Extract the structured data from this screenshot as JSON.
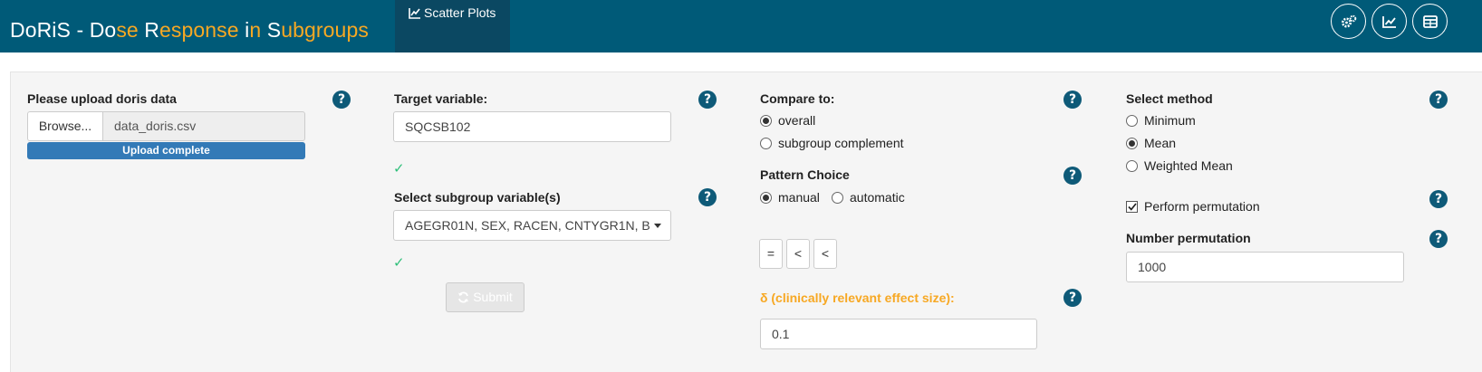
{
  "app": {
    "title_parts": [
      {
        "text": "DoRiS - Do",
        "hl": false
      },
      {
        "text": "se",
        "hl": true
      },
      {
        "text": " R",
        "hl": false
      },
      {
        "text": "esponse",
        "hl": true
      },
      {
        "text": " i",
        "hl": false
      },
      {
        "text": "n",
        "hl": true
      },
      {
        "text": " S",
        "hl": false
      },
      {
        "text": "ubgroups",
        "hl": true
      }
    ],
    "nav_tab": "Scatter Plots",
    "header_buttons": [
      "gears-icon",
      "line-chart-icon",
      "table-icon"
    ]
  },
  "colors": {
    "navbar": "#005a78",
    "accent": "#f7a823",
    "tab_active": "#0b4862",
    "progress": "#337ab7",
    "help": "#0e5a78",
    "check": "#2fbf7a"
  },
  "upload": {
    "label": "Please upload doris data",
    "browse_label": "Browse...",
    "filename": "data_doris.csv",
    "progress_text": "Upload complete",
    "progress": 1.0
  },
  "target": {
    "label": "Target variable:",
    "value": "SQCSB102"
  },
  "subgroup": {
    "label": "Select subgroup variable(s)",
    "value": "AGEGR01N, SEX, RACEN, CNTYGR1N, B"
  },
  "submit_label": "Submit",
  "compare": {
    "label": "Compare to:",
    "options": [
      {
        "label": "overall",
        "selected": true
      },
      {
        "label": "subgroup complement",
        "selected": false
      }
    ]
  },
  "pattern": {
    "label": "Pattern Choice",
    "options": [
      {
        "label": "manual",
        "selected": true
      },
      {
        "label": "automatic",
        "selected": false
      }
    ],
    "buttons": [
      "=",
      "<",
      "<"
    ]
  },
  "delta": {
    "label": "δ (clinically relevant effect size):",
    "value": "0.1"
  },
  "method": {
    "label": "Select method",
    "options": [
      {
        "label": "Minimum",
        "selected": false
      },
      {
        "label": "Mean",
        "selected": true
      },
      {
        "label": "Weighted Mean",
        "selected": false
      }
    ]
  },
  "permutation": {
    "checkbox_label": "Perform permutation",
    "checked": true,
    "number_label": "Number permutation",
    "number_value": "1000"
  }
}
